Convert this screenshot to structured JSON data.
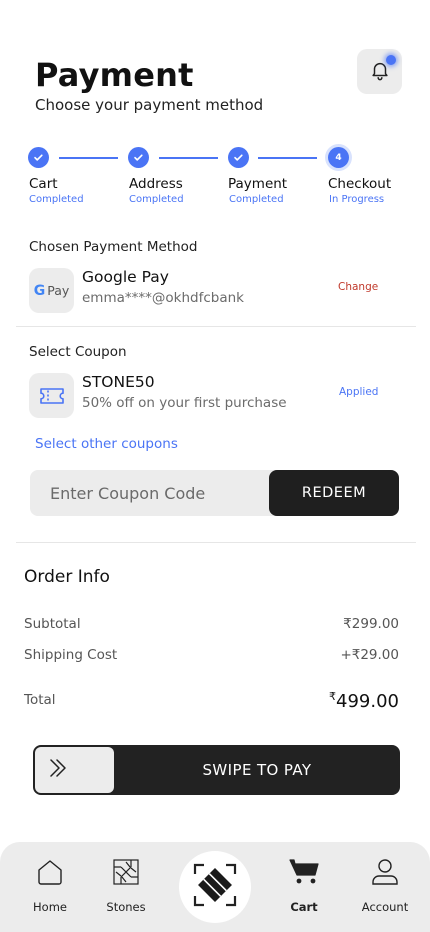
{
  "header": {
    "title": "Payment",
    "subtitle": "Choose your payment method"
  },
  "steps": [
    {
      "label": "Cart",
      "status": "Completed",
      "state": "done"
    },
    {
      "label": "Address",
      "status": "Completed",
      "state": "done"
    },
    {
      "label": "Payment",
      "status": "Completed",
      "state": "done"
    },
    {
      "label": "Checkout",
      "status": "In Progress",
      "state": "active",
      "number": "4"
    }
  ],
  "payment_method": {
    "section_title": "Chosen Payment Method",
    "icon_text": "Pay",
    "name": "Google Pay",
    "account": "emma****@okhdfcbank",
    "change_label": "Change"
  },
  "coupon": {
    "section_title": "Select Coupon",
    "code": "STONE50",
    "description": "50% off on your first purchase",
    "status_label": "Applied",
    "select_other_label": "Select other coupons",
    "input_placeholder": "Enter Coupon Code",
    "redeem_label": "REDEEM"
  },
  "order_info": {
    "title": "Order Info",
    "subtotal_label": "Subtotal",
    "subtotal_value": "₹299.00",
    "shipping_label": "Shipping Cost",
    "shipping_value": "+₹29.00",
    "total_label": "Total",
    "total_currency": "₹",
    "total_amount": "499.00"
  },
  "swipe": {
    "label": "SWIPE TO PAY"
  },
  "nav": {
    "items": [
      {
        "label": "Home",
        "icon": "home-icon"
      },
      {
        "label": "Stones",
        "icon": "stones-icon"
      },
      {
        "label": "Cart",
        "icon": "cart-icon",
        "active": true
      },
      {
        "label": "Account",
        "icon": "account-icon"
      }
    ]
  },
  "colors": {
    "accent": "#4a74f5",
    "danger": "#c0392b",
    "dark": "#1f1f1f",
    "surface": "#ececec"
  }
}
